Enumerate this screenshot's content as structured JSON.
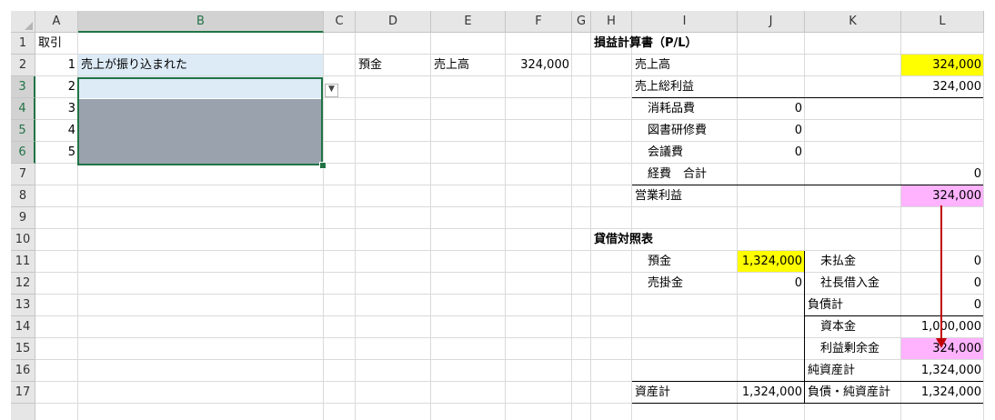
{
  "columns": [
    "A",
    "B",
    "C",
    "D",
    "E",
    "F",
    "G",
    "H",
    "I",
    "J",
    "K",
    "L"
  ],
  "rows": [
    "1",
    "2",
    "3",
    "4",
    "5",
    "6",
    "7",
    "8",
    "9",
    "10",
    "11",
    "12",
    "13",
    "14",
    "15",
    "16",
    "17"
  ],
  "journal": {
    "header": "取引",
    "nums": [
      "1",
      "2",
      "3",
      "4",
      "5"
    ],
    "row2_desc": "売上が振り込まれた",
    "row2_debit": "預金",
    "row2_credit": "売上高",
    "row2_amount": "324,000"
  },
  "pl": {
    "title": "損益計算書（P/L）",
    "sales_label": "売上高",
    "sales_value": "324,000",
    "gross_label": "売上総利益",
    "gross_value": "324,000",
    "supplies_label": "消耗品費",
    "supplies_value": "0",
    "books_label": "図書研修費",
    "books_value": "0",
    "meeting_label": "会議費",
    "meeting_value": "0",
    "expense_total_label": "経費　合計",
    "expense_total_value": "0",
    "operating_label": "営業利益",
    "operating_value": "324,000"
  },
  "bs": {
    "title": "貸借対照表",
    "deposit_label": "預金",
    "deposit_value": "1,324,000",
    "receivable_label": "売掛金",
    "receivable_value": "0",
    "unpaid_label": "未払金",
    "unpaid_value": "0",
    "loan_label": "社長借入金",
    "loan_value": "0",
    "liab_total_label": "負債計",
    "liab_total_value": "0",
    "capital_label": "資本金",
    "capital_value": "1,000,000",
    "retained_label": "利益剰余金",
    "retained_value": "324,000",
    "net_assets_label": "純資産計",
    "net_assets_value": "1,324,000",
    "assets_total_label": "資産計",
    "assets_total_value": "1,324,000",
    "liab_net_total_label": "負債・純資産計",
    "liab_net_total_value": "1,324,000"
  },
  "colors": {
    "accent": "#217346",
    "highlight_yellow": "#ffff00",
    "highlight_pink": "#ffb3ff",
    "selection_blue": "#ddebf7",
    "arrow": "#c00000"
  }
}
